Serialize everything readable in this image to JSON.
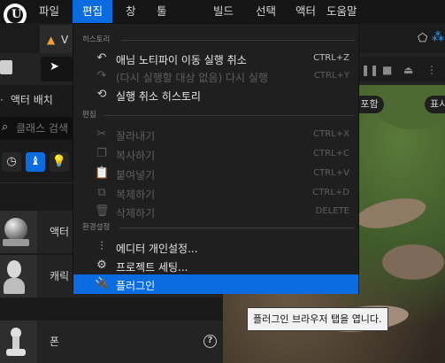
{
  "app": {
    "logo_letter": "U"
  },
  "menubar": {
    "items": [
      {
        "label": "파일"
      },
      {
        "label": "편집"
      },
      {
        "label": "창"
      },
      {
        "label": "툴"
      },
      {
        "label": "빌드"
      },
      {
        "label": "선택"
      },
      {
        "label": "액터"
      },
      {
        "label": "도움말"
      }
    ],
    "active_index": 1
  },
  "tab": {
    "label_fragment": "V",
    "warning_glyph": "▲"
  },
  "left_panel": {
    "title": "액터 배치",
    "search_placeholder": "클래스 검색",
    "categories": [
      {
        "icon": "clock-icon",
        "glyph": "◷"
      },
      {
        "icon": "shapes-icon",
        "glyph": "♝",
        "active": true
      },
      {
        "icon": "bulb-icon",
        "glyph": "💡"
      }
    ],
    "assets": [
      {
        "name": "액터",
        "icon": "sphere-icon"
      },
      {
        "name": "캐릭",
        "icon": "character-icon"
      },
      {
        "name": "폰",
        "icon": "pawn-icon"
      }
    ],
    "help_glyph": "?"
  },
  "viewport": {
    "chip_left": "라이팅포함",
    "chip_right": "표시"
  },
  "edit_menu": {
    "sections": [
      {
        "label": "히스토리",
        "items": [
          {
            "icon": "undo-icon",
            "glyph": "↶",
            "label": "애님 노티파이 이동 실행 취소",
            "shortcut": "CTRL+Z",
            "enabled": true
          },
          {
            "icon": "redo-icon",
            "glyph": "↷",
            "label": "(다시 실행할 대상 없음) 다시 실행",
            "shortcut": "CTRL+Y",
            "enabled": false
          },
          {
            "icon": "history-icon",
            "glyph": "⟲",
            "label": "실행 취소 히스토리",
            "shortcut": "",
            "enabled": true
          }
        ]
      },
      {
        "label": "편집",
        "items": [
          {
            "icon": "cut-icon",
            "glyph": "✂",
            "label": "잘라내기",
            "shortcut": "CTRL+X",
            "enabled": false
          },
          {
            "icon": "copy-icon",
            "glyph": "❐",
            "label": "복사하기",
            "shortcut": "CTRL+C",
            "enabled": false
          },
          {
            "icon": "paste-icon",
            "glyph": "📋",
            "label": "붙여넣기",
            "shortcut": "CTRL+V",
            "enabled": false
          },
          {
            "icon": "duplicate-icon",
            "glyph": "⧉",
            "label": "복제하기",
            "shortcut": "CTRL+D",
            "enabled": false
          },
          {
            "icon": "delete-icon",
            "glyph": "🗑",
            "label": "삭제하기",
            "shortcut": "DELETE",
            "enabled": false
          }
        ]
      },
      {
        "label": "환경설정",
        "items": [
          {
            "icon": "sliders-icon",
            "glyph": "⫶",
            "label": "에디터 개인설정...",
            "shortcut": "",
            "enabled": true
          },
          {
            "icon": "project-settings-icon",
            "glyph": "⚙",
            "label": "프로젝트 세팅...",
            "shortcut": "",
            "enabled": true
          },
          {
            "icon": "plugin-icon",
            "glyph": "🔌",
            "label": "플러그인",
            "shortcut": "",
            "enabled": true,
            "highlighted": true
          }
        ]
      }
    ]
  },
  "tooltip": {
    "text": "플러그인 브라우저 탭을 엽니다."
  }
}
